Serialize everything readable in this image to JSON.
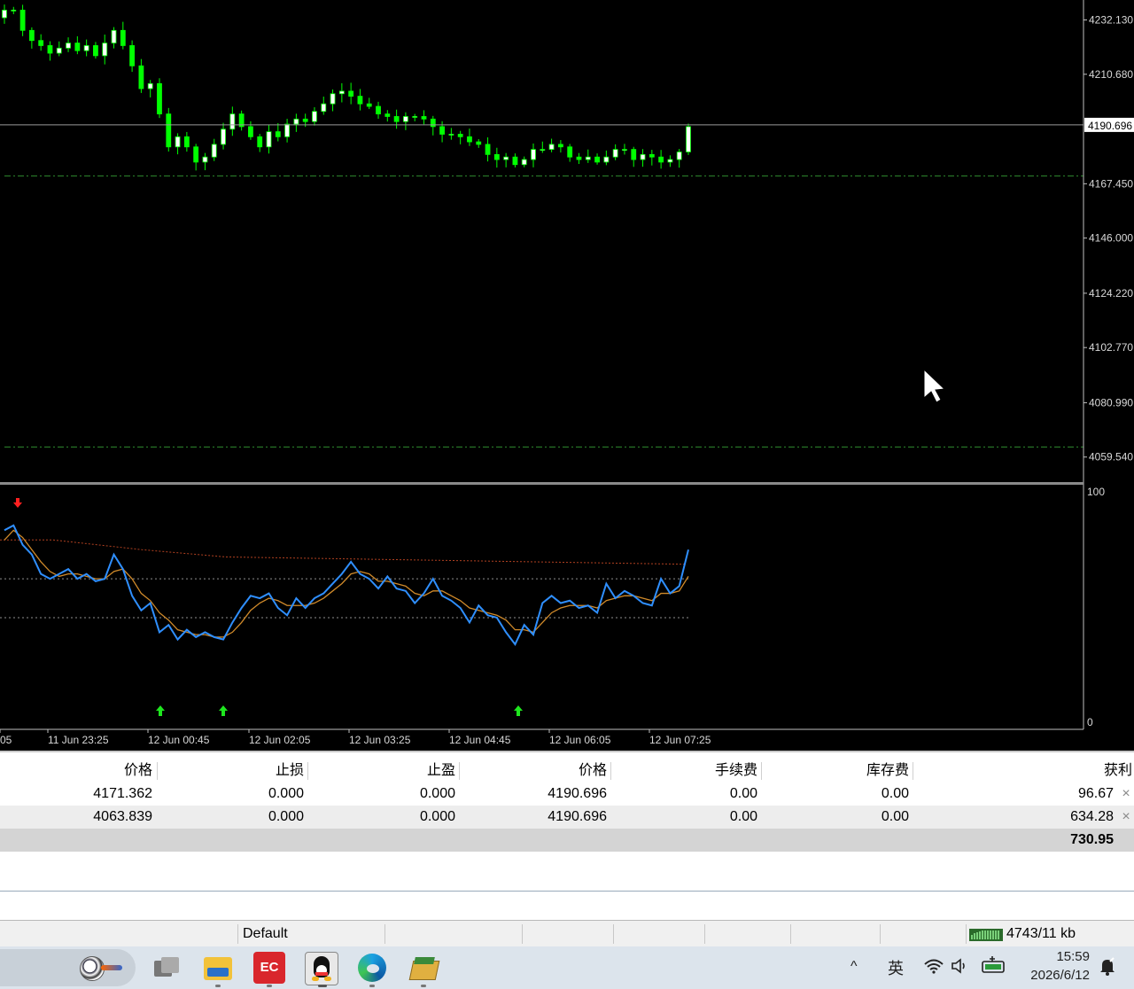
{
  "chart": {
    "price_axis": [
      "4232.130",
      "4210.680",
      "4167.450",
      "4146.000",
      "4124.220",
      "4102.770",
      "4080.990",
      "4059.540"
    ],
    "current_price": "4190.696",
    "osc_axis": [
      "100",
      "0"
    ],
    "time_axis": [
      "05",
      "11 Jun 23:25",
      "12 Jun 00:45",
      "12 Jun 02:05",
      "12 Jun 03:25",
      "12 Jun 04:45",
      "12 Jun 06:05",
      "12 Jun 07:25"
    ],
    "colors": {
      "background": "#000000",
      "bull_candle": "#ffffff",
      "bear_candle": "#00ff00",
      "wick": "#00ff00",
      "bid_line": "#9a9a9a",
      "level_line": "#2e8b2e",
      "osc_main": "#2f8fff",
      "osc_signal": "#d08a2a",
      "osc_slow": "#b04020",
      "osc_levels": "#909090",
      "arrow_up": "#1ee61e",
      "arrow_down": "#ff2020"
    }
  },
  "chart_data": {
    "type": "candlestick",
    "x": [
      "11 Jun 23:25",
      "12 Jun 00:45",
      "12 Jun 02:05",
      "12 Jun 03:25",
      "12 Jun 04:45",
      "12 Jun 06:05",
      "12 Jun 07:25"
    ],
    "close_path": [
      4236,
      4236,
      4228,
      4224,
      4222,
      4219,
      4221,
      4223,
      4220,
      4222,
      4218,
      4223,
      4228,
      4222,
      4214,
      4205,
      4207,
      4195,
      4182,
      4186,
      4182,
      4176,
      4178,
      4183,
      4189,
      4195,
      4190,
      4186,
      4182,
      4188,
      4186,
      4191,
      4193,
      4192,
      4196,
      4199,
      4203,
      4204,
      4202,
      4199,
      4198,
      4195,
      4194,
      4192,
      4194,
      4194,
      4193,
      4190,
      4187,
      4187,
      4186,
      4184,
      4183,
      4179,
      4177,
      4178,
      4175,
      4177,
      4181,
      4181,
      4183,
      4182,
      4178,
      4177,
      4178,
      4176,
      4178,
      4181,
      4181,
      4177,
      4179,
      4178,
      4176,
      4177,
      4180,
      4190
    ],
    "ylim": [
      4050,
      4240
    ],
    "bid_price": 4190.696,
    "levels": [
      4170.5,
      4063.5
    ],
    "oscillator": {
      "range": [
        0,
        100
      ],
      "levels": [
        62,
        46
      ],
      "main": [
        82,
        84,
        76,
        72,
        64,
        62,
        64,
        66,
        62,
        64,
        61,
        62,
        72,
        66,
        55,
        49,
        52,
        40,
        43,
        37,
        41,
        38,
        40,
        38,
        37,
        44,
        50,
        55,
        54,
        56,
        50,
        47,
        54,
        50,
        54,
        56,
        60,
        64,
        69,
        64,
        62,
        58,
        63,
        58,
        57,
        52,
        56,
        62,
        55,
        53,
        50,
        44,
        51,
        47,
        46,
        40,
        35,
        43,
        39,
        52,
        55,
        52,
        53,
        50,
        51,
        48,
        60,
        54,
        57,
        55,
        52,
        51,
        62,
        56,
        59,
        74
      ],
      "signal": [
        78,
        82,
        79,
        74,
        69,
        65,
        63,
        64,
        64,
        63,
        62,
        62,
        65,
        66,
        62,
        56,
        53,
        48,
        45,
        41,
        40,
        39,
        39,
        38,
        38,
        40,
        44,
        49,
        52,
        54,
        53,
        51,
        51,
        51,
        52,
        54,
        57,
        60,
        64,
        65,
        64,
        61,
        61,
        60,
        59,
        56,
        55,
        57,
        57,
        55,
        53,
        50,
        49,
        48,
        47,
        45,
        41,
        41,
        40,
        44,
        48,
        50,
        51,
        51,
        51,
        50,
        53,
        54,
        55,
        55,
        54,
        53,
        56,
        56,
        57,
        63
      ],
      "slow_line": [
        78,
        78,
        74,
        71,
        68
      ],
      "arrows_up_time": [
        "12 Jun 00:45",
        "12 Jun 01:25",
        "12 Jun 05:05"
      ],
      "arrow_down_time": "11 Jun 22:45"
    }
  },
  "positions_table": {
    "headers": [
      "价格",
      "止损",
      "止盈",
      "价格",
      "手续费",
      "库存费",
      "获利"
    ],
    "rows": [
      [
        "4171.362",
        "0.000",
        "0.000",
        "4190.696",
        "0.00",
        "0.00",
        "96.67"
      ],
      [
        "4063.839",
        "0.000",
        "0.000",
        "4190.696",
        "0.00",
        "0.00",
        "634.28"
      ]
    ],
    "total_profit": "730.95",
    "close_icon": "×"
  },
  "status_bar": {
    "profile": "Default",
    "traffic": "4743/11 kb"
  },
  "taskbar": {
    "apps": [
      "soccer-app-icon",
      "task-view-icon",
      "file-explorer-icon",
      "ec-app-icon",
      "qq-icon",
      "edge-icon",
      "archive-app-icon"
    ],
    "ec_label": "EC",
    "ime": "英",
    "time": "15:59",
    "date": "2026/6/12"
  }
}
